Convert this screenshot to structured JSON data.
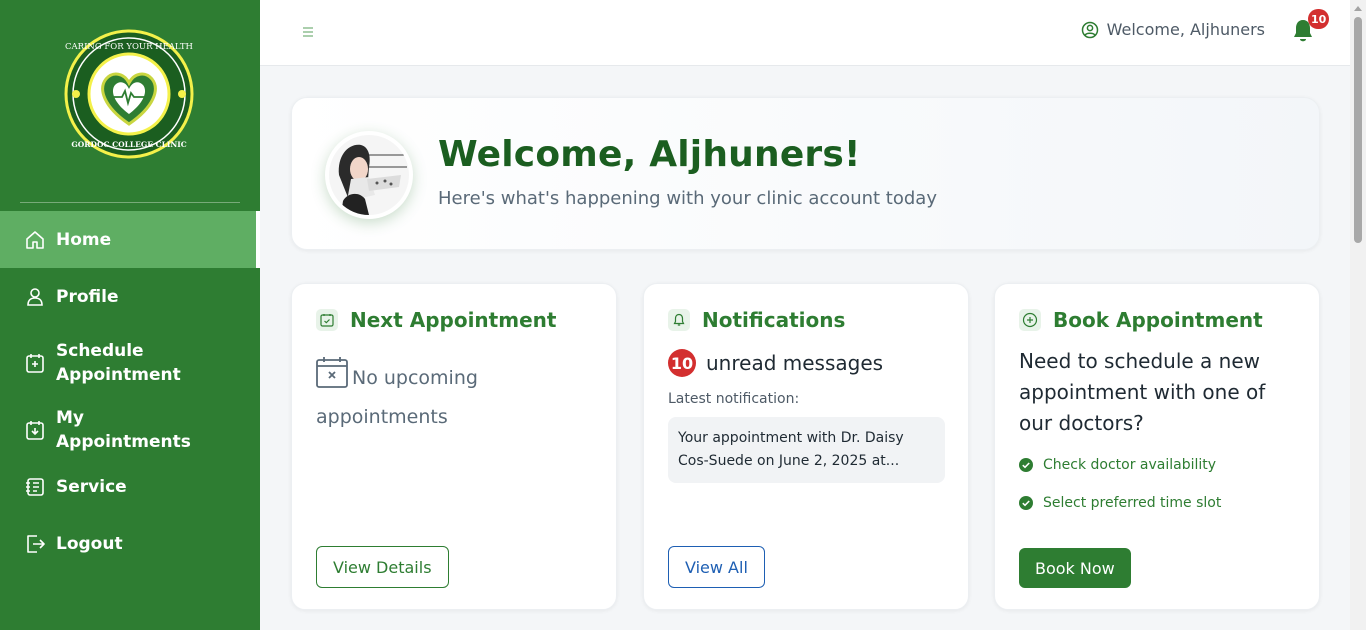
{
  "sidebar": {
    "logo_text": "CARING FOR YOUR HEALTH · GORDOC COLLEGE CLINIC",
    "items": [
      {
        "label": "Home",
        "icon": "home-icon"
      },
      {
        "label": "Profile",
        "icon": "user-icon"
      },
      {
        "label": "Schedule Appointment",
        "icon": "calendar-plus-icon"
      },
      {
        "label": "My Appointments",
        "icon": "calendar-download-icon"
      },
      {
        "label": "Service",
        "icon": "notebook-icon"
      },
      {
        "label": "Logout",
        "icon": "logout-icon"
      }
    ],
    "active_item": "Home"
  },
  "header": {
    "welcome_text": "Welcome, Aljhuners",
    "notification_count": "10"
  },
  "banner": {
    "title": "Welcome, Aljhuners!",
    "subtitle": "Here's what's happening with your clinic account today"
  },
  "cards": {
    "next_appointment": {
      "title": "Next Appointment",
      "empty_text": "No upcoming appointments",
      "button_label": "View Details"
    },
    "notifications": {
      "title": "Notifications",
      "unread_count": "10",
      "unread_text": "unread messages",
      "latest_label": "Latest notification:",
      "latest_text": "Your appointment with Dr. Daisy Cos-Suede on June 2, 2025 at...",
      "button_label": "View All"
    },
    "book_appointment": {
      "title": "Book Appointment",
      "description": "Need to schedule a new appointment with one of our doctors?",
      "checks": [
        "Check doctor availability",
        "Select preferred time slot"
      ],
      "button_label": "Book Now"
    }
  },
  "colors": {
    "primary_green": "#2e7d32",
    "active_nav": "#5fae63",
    "badge_red": "#d32f2f",
    "link_blue": "#1e5fb3"
  }
}
